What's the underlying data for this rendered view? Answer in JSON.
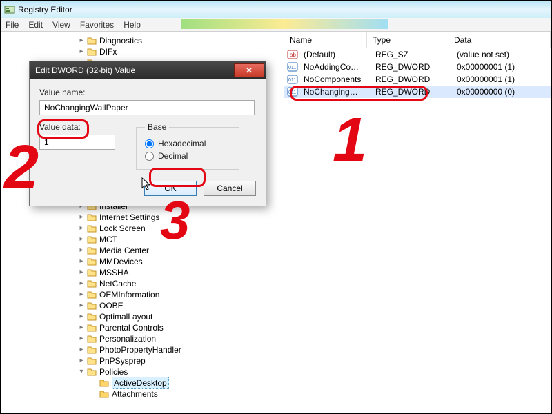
{
  "app": {
    "title": "Registry Editor"
  },
  "menu": {
    "file": "File",
    "edit": "Edit",
    "view": "View",
    "favorites": "Favorites",
    "help": "Help"
  },
  "tree": {
    "items": [
      "Diagnostics",
      "DIFx",
      "…",
      "…",
      "…",
      "…",
      "…",
      "…",
      "…",
      "…",
      "…",
      "…",
      "…",
      "…",
      "…",
      "Installer",
      "Internet Settings",
      "Lock Screen",
      "MCT",
      "Media Center",
      "MMDevices",
      "MSSHA",
      "NetCache",
      "OEMInformation",
      "OOBE",
      "OptimalLayout",
      "Parental Controls",
      "Personalization",
      "PhotoPropertyHandler",
      "PnPSysprep",
      "Policies"
    ],
    "policies_children": [
      "ActiveDesktop",
      "Attachments"
    ]
  },
  "values": {
    "header": {
      "name": "Name",
      "type": "Type",
      "data": "Data"
    },
    "rows": [
      {
        "name": "(Default)",
        "type": "REG_SZ",
        "data": "(value not set)",
        "icon": "str"
      },
      {
        "name": "NoAddingCom...",
        "type": "REG_DWORD",
        "data": "0x00000001 (1)",
        "icon": "dw"
      },
      {
        "name": "NoComponents",
        "type": "REG_DWORD",
        "data": "0x00000001 (1)",
        "icon": "dw"
      },
      {
        "name": "NoChangingWa...",
        "type": "REG_DWORD",
        "data": "0x00000000 (0)",
        "icon": "dw",
        "selected": true
      }
    ]
  },
  "dialog": {
    "title": "Edit DWORD (32-bit) Value",
    "value_name_label": "Value name:",
    "value_name": "NoChangingWallPaper",
    "value_data_label": "Value data:",
    "value_data": "1",
    "base_label": "Base",
    "hex_label": "Hexadecimal",
    "dec_label": "Decimal",
    "ok": "OK",
    "cancel": "Cancel"
  },
  "annotations": {
    "n1": "1",
    "n2": "2",
    "n3": "3"
  }
}
